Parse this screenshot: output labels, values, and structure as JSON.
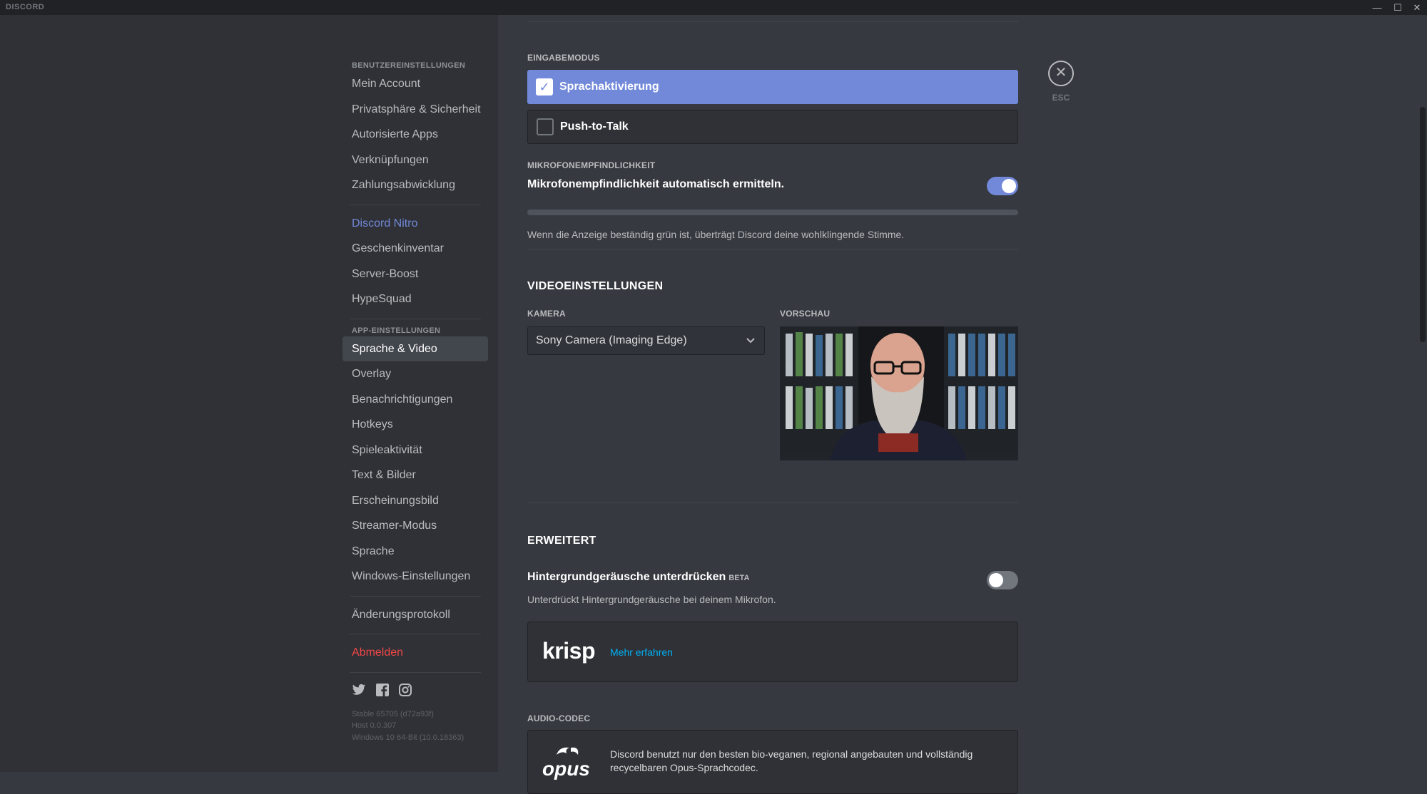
{
  "window": {
    "app_name": "DISCORD",
    "minimize": "—",
    "maximize": "☐",
    "close": "✕"
  },
  "sidebar": {
    "section_user": "BENUTZEREINSTELLUNGEN",
    "user_items": [
      "Mein Account",
      "Privatsphäre & Sicherheit",
      "Autorisierte Apps",
      "Verknüpfungen",
      "Zahlungsabwicklung"
    ],
    "nitro_items": [
      "Discord Nitro",
      "Geschenkinventar",
      "Server-Boost",
      "HypeSquad"
    ],
    "section_app": "APP-EINSTELLUNGEN",
    "app_items": [
      "Sprache & Video",
      "Overlay",
      "Benachrichtigungen",
      "Hotkeys",
      "Spieleaktivität",
      "Text & Bilder",
      "Erscheinungsbild",
      "Streamer-Modus",
      "Sprache",
      "Windows-Einstellungen"
    ],
    "active_item": "Sprache & Video",
    "changelog": "Änderungsprotokoll",
    "logout": "Abmelden",
    "version_lines": [
      "Stable 65705 (d72a93f)",
      "Host 0.0.307",
      "Windows 10 64-Bit (10.0.18363)"
    ]
  },
  "main": {
    "input_mode_label": "EINGABEMODUS",
    "input_modes": [
      {
        "label": "Sprachaktivierung",
        "selected": true
      },
      {
        "label": "Push-to-Talk",
        "selected": false
      }
    ],
    "mic_sensitivity_label": "MIKROFONEMPFINDLICHKEIT",
    "mic_auto_label": "Mikrofonempfindlichkeit automatisch ermitteln.",
    "mic_auto_enabled": true,
    "mic_hint": "Wenn die Anzeige beständig grün ist, überträgt Discord deine wohlklingende Stimme.",
    "video_section": "VIDEOEINSTELLUNGEN",
    "camera_label": "KAMERA",
    "camera_value": "Sony Camera (Imaging Edge)",
    "preview_label": "VORSCHAU",
    "advanced_section": "ERWEITERT",
    "noise_title": "Hintergrundgeräusche unterdrücken",
    "noise_beta": "BETA",
    "noise_enabled": false,
    "noise_desc": "Unterdrückt Hintergrundgeräusche bei deinem Mikrofon.",
    "krisp_logo": "krisp",
    "krisp_link": "Mehr erfahren",
    "codec_label": "AUDIO-CODEC",
    "opus_logo": "opus",
    "opus_text_1": "Discord benutzt nur den besten bio-veganen, regional angebauten und vollständig",
    "opus_text_2": "recycelbaren Opus-Sprachcodec."
  },
  "close_button": {
    "icon": "close-icon",
    "label": "ESC"
  },
  "colors": {
    "accent": "#7289da",
    "danger": "#f04747",
    "link": "#00b0f4"
  }
}
